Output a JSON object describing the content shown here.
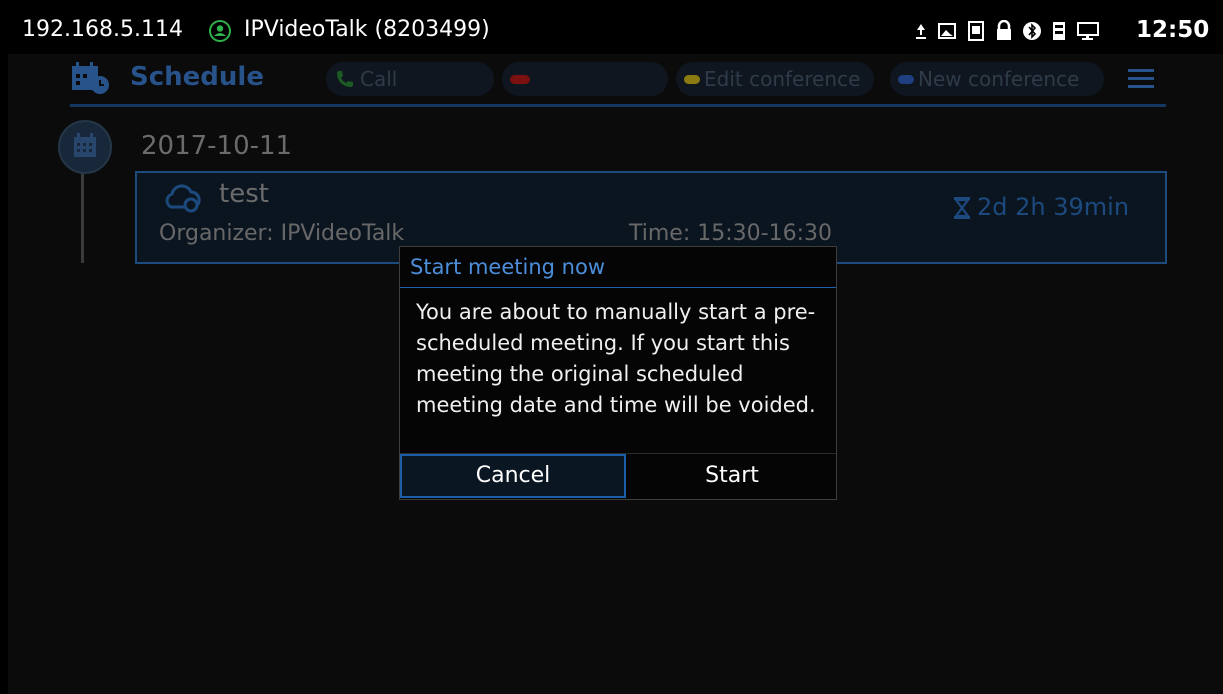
{
  "status_bar": {
    "ip": "192.168.5.114",
    "account": "IPVideoTalk (8203499)",
    "time": "12:50",
    "icons": [
      "upload-icon",
      "image-icon",
      "sim-icon",
      "lock-icon",
      "bluetooth-icon",
      "storage-icon",
      "network-icon"
    ]
  },
  "header": {
    "title": "Schedule",
    "buttons": [
      {
        "label": "Call",
        "color": "#1e5a24"
      },
      {
        "label": "",
        "color": "#7a1010"
      },
      {
        "label": "Edit conference",
        "color": "#8a7a10"
      },
      {
        "label": "New conference",
        "color": "#1f3f80"
      }
    ]
  },
  "schedule": {
    "date": "2017-10-11",
    "meeting": {
      "name": "test",
      "organizer": "Organizer: IPVideoTalk",
      "time": "Time: 15:30-16:30",
      "countdown": "2d 2h 39min"
    }
  },
  "dialog": {
    "title": "Start meeting now",
    "message": "You are about to manually start a pre-scheduled meeting. If you start this meeting the original scheduled meeting date and time will be voided.",
    "cancel": "Cancel",
    "start": "Start"
  }
}
